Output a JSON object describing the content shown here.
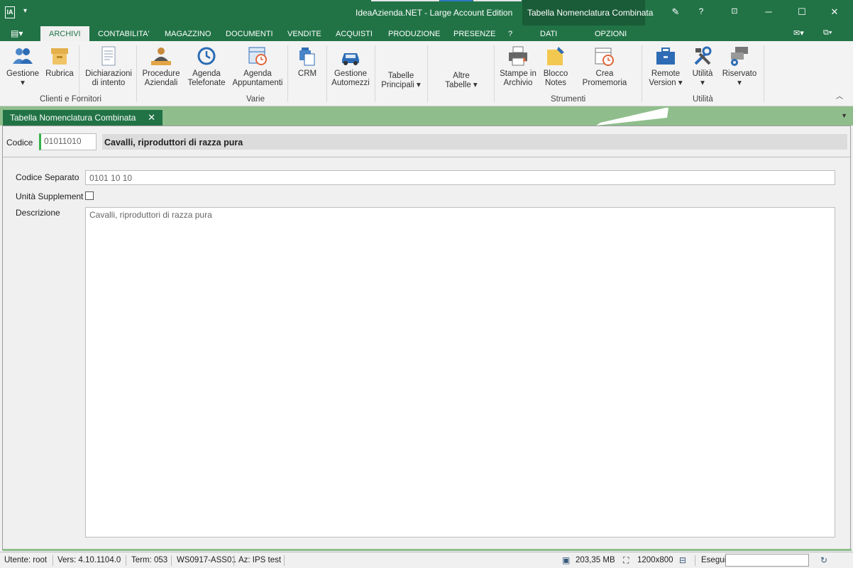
{
  "window": {
    "app_icon": "IA",
    "title": "IdeaAzienda.NET - Large Account Edition",
    "context_title": "Tabella Nomenclatura Combinata",
    "buttons": {
      "help": "?",
      "minimize": "─",
      "maximize": "☐",
      "close": "✕"
    }
  },
  "ribbon_tabs": [
    "ARCHIVI",
    "CONTABILITA'",
    "MAGAZZINO",
    "DOCUMENTI",
    "VENDITE",
    "ACQUISTI",
    "PRODUZIONE",
    "PRESENZE",
    "?",
    "DATI",
    "OPZIONI"
  ],
  "ribbon": {
    "gestione": "Gestione",
    "rubrica": "Rubrica",
    "dichiarazioni": [
      "Dichiarazioni",
      "di intento"
    ],
    "procedure": [
      "Procedure",
      "Aziendali"
    ],
    "agenda_tel": [
      "Agenda",
      "Telefonate"
    ],
    "agenda_app": [
      "Agenda",
      "Appuntamenti"
    ],
    "crm": "CRM",
    "automezzi": [
      "Gestione",
      "Automezzi"
    ],
    "tabelle_principali": [
      "Tabelle",
      "Principali ▾"
    ],
    "altre_tabelle": [
      "Altre",
      "Tabelle ▾"
    ],
    "stampe": [
      "Stampe in",
      "Archivio"
    ],
    "blocco": [
      "Blocco",
      "Notes"
    ],
    "promemoria": "Crea Promemoria",
    "remote": [
      "Remote",
      "Version ▾"
    ],
    "utilita": "Utilità",
    "riservato": "Riservato",
    "groups": {
      "clienti": "Clienti e Fornitori",
      "varie": "Varie",
      "strumenti": "Strumenti",
      "utilita": "Utilità"
    }
  },
  "doc_tab": {
    "label": "Tabella Nomenclatura Combinata",
    "close": "✕"
  },
  "form": {
    "codice_label": "Codice",
    "codice_value": "01011010",
    "codice_desc": "Cavalli, riproduttori di razza pura",
    "codice_separato_label": "Codice Separato",
    "codice_separato_value": "0101 10 10",
    "unita_label": "Unità Supplement",
    "unita_checked": false,
    "descrizione_label": "Descrizione",
    "descrizione_value": "Cavalli, riproduttori di razza pura"
  },
  "status": {
    "utente": "Utente: root",
    "versione": "Vers: 4.10.1104.0",
    "term": "Term: 053",
    "ws": "WS0917-ASS01",
    "az": "Az: IPS test",
    "memory": "203,35 MB",
    "resolution": "1200x800",
    "esegui_label": "Esegui",
    "esegui_value": ""
  },
  "colors": {
    "accent": "#217346",
    "docstrip": "#8fbe8c",
    "indicator": "#33b249"
  }
}
